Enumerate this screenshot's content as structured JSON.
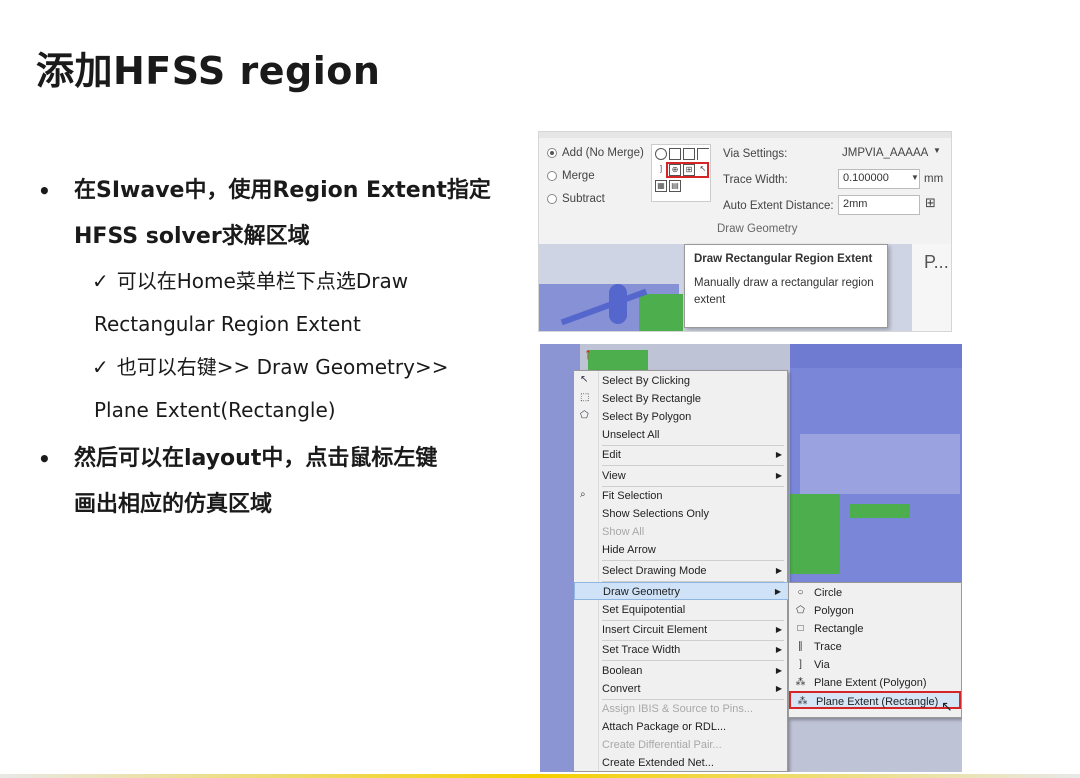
{
  "slide": {
    "title": "添加HFSS region",
    "bullets": [
      {
        "text_line1": "在SIwave中，使用Region Extent指定",
        "text_line2": "HFSS solver求解区域"
      },
      {
        "text_line1": "然后可以在layout中，点击鼠标左键",
        "text_line2": "画出相应的仿真区域"
      }
    ],
    "bullet_glyph": "•",
    "check_glyph": "✓",
    "sub1_line1": "可以在Home菜单栏下点选Draw",
    "sub1_line2": "Rectangular Region Extent",
    "sub2_line1": "也可以右键>> Draw Geometry>>",
    "sub2_line2": "Plane Extent(Rectangle)"
  },
  "ribbon": {
    "radio_add": "Add (No Merge)",
    "radio_merge": "Merge",
    "radio_subtract": "Subtract",
    "via_settings_label": "Via Settings:",
    "via_settings_value": "JMPVIA_AAAAA",
    "trace_width_label": "Trace Width:",
    "trace_width_value": "0.100000",
    "trace_width_unit": "mm",
    "auto_extent_label": "Auto Extent Distance:",
    "auto_extent_value": "2mm",
    "group_label": "Draw Geometry",
    "tooltip_title": "Draw Rectangular Region Extent",
    "tooltip_body": "Manually draw a rectangular region extent",
    "pane_label": "P..."
  },
  "context_menu": {
    "items": [
      "Select By Clicking",
      "Select By Rectangle",
      "Select By Polygon",
      "Unselect All",
      "Edit",
      "View",
      "Fit Selection",
      "Show Selections Only",
      "Show All",
      "Hide Arrow",
      "Select Drawing Mode",
      "Draw Geometry",
      "Set Equipotential",
      "Insert Circuit Element",
      "Set Trace Width",
      "Boolean",
      "Convert",
      "Assign IBIS & Source to Pins...",
      "Attach Package or RDL...",
      "Create Differential Pair...",
      "Create Extended Net..."
    ],
    "submenu": [
      "Circle",
      "Polygon",
      "Rectangle",
      "Trace",
      "Via",
      "Plane Extent (Polygon)",
      "Plane Extent (Rectangle)"
    ],
    "colors": {
      "highlight": "#cfe2f7",
      "selection_box": "#d42626",
      "pcb_green": "#4cae4c",
      "pcb_blue": "#5566cc"
    }
  }
}
